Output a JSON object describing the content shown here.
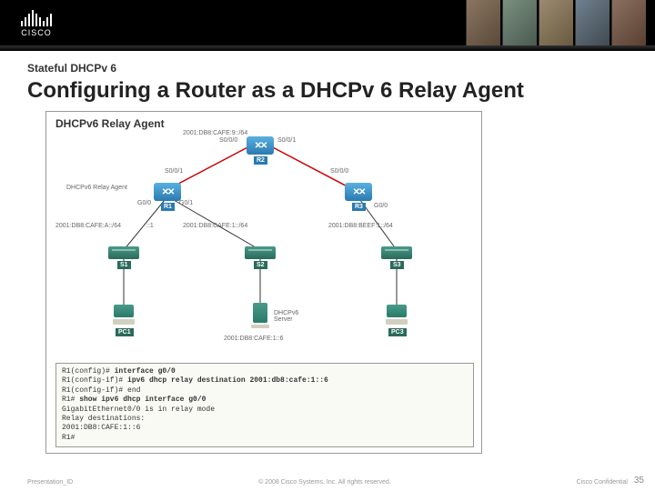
{
  "banner": {
    "logo_text": "CISCO"
  },
  "breadcrumb": "Stateful DHCPv 6",
  "title": "Configuring a Router as a DHCPv 6 Relay Agent",
  "diagram": {
    "box_title": "DHCPv6 Relay Agent",
    "top_net": "2001:DB8:CAFE:9::/64",
    "r2": "R2",
    "r1": "R1",
    "r3": "R3",
    "s00_l": "S0/0/0",
    "s00_r": "S0/0/1",
    "s00_rl": "S0/0/1",
    "s00_rr": "S0/0/0",
    "relay_note": "DHCPv6 Relay Agent",
    "g00": "G0/0",
    "g01": "G0/1",
    "g00r": "G0/0",
    "net_a": "2001:DB8:CAFE:A::/64",
    "addr1": "::1",
    "net1": "2001:DB8:CAFE:1::/64",
    "netb": "2001:DB8:BEEF:1::/64",
    "s1": "S1",
    "s2": "S2",
    "s3": "S3",
    "pc1": "PC1",
    "pc3": "PC3",
    "srv_label": "DHCPv6\nServer",
    "srv_addr": "2001:DB8:CAFE:1::6"
  },
  "cli": {
    "l1a": "R1(config)# ",
    "l1b": "interface g0/0",
    "l2a": "R1(config-if)# ",
    "l2b": "ipv6 dhcp relay destination 2001:db8:cafe:1::6",
    "l3": "R1(config-if)# end",
    "l4a": "R1# ",
    "l4b": "show ipv6 dhcp interface g0/0",
    "l5": "GigabitEthernet0/0 is in relay mode",
    "l6": "  Relay destinations:",
    "l7": "    2001:DB8:CAFE:1::6",
    "l8": "R1#"
  },
  "footer": {
    "left": "Presentation_ID",
    "center": "© 2008 Cisco Systems, Inc. All rights reserved.",
    "right": "Cisco Confidential",
    "page": "35"
  }
}
